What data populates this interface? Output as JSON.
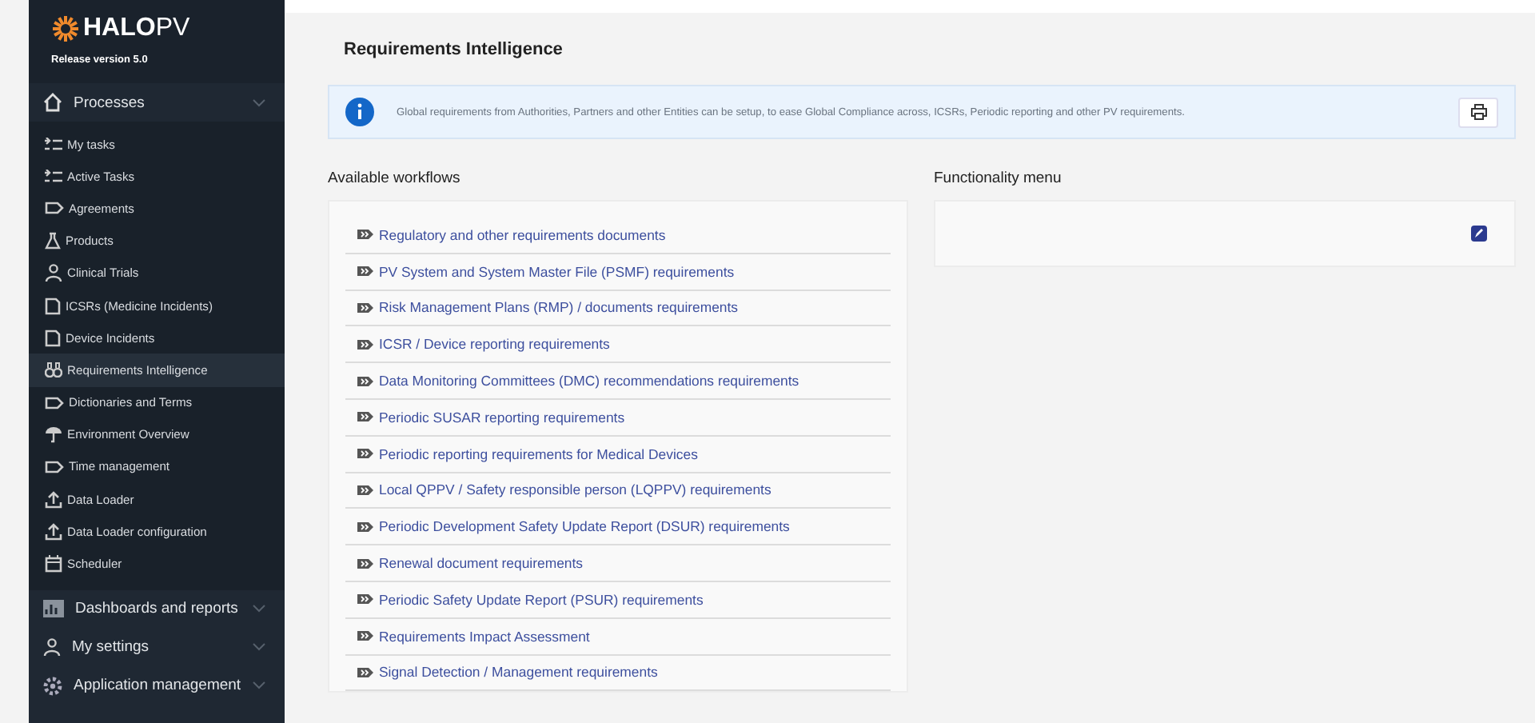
{
  "sidebar": {
    "logo": {
      "brand_bold": "HALO",
      "brand_light": "PV"
    },
    "release": "Release version 5.0",
    "sections": [
      {
        "label": "Processes",
        "expanded": true,
        "items": [
          {
            "label": "My tasks",
            "selected": false
          },
          {
            "label": "Active Tasks",
            "selected": false
          },
          {
            "label": "Agreements",
            "selected": false
          },
          {
            "label": "Products",
            "selected": false
          },
          {
            "label": "Clinical Trials",
            "selected": false
          },
          {
            "label": "ICSRs (Medicine Incidents)",
            "selected": false
          },
          {
            "label": "Device Incidents",
            "selected": false
          },
          {
            "label": "Requirements Intelligence",
            "selected": true
          },
          {
            "label": "Dictionaries and Terms",
            "selected": false
          },
          {
            "label": "Environment Overview",
            "selected": false
          },
          {
            "label": "Time management",
            "selected": false
          },
          {
            "label": "Data Loader",
            "selected": false
          },
          {
            "label": "Data Loader configuration",
            "selected": false
          },
          {
            "label": "Scheduler",
            "selected": false
          }
        ]
      },
      {
        "label": "Dashboards and reports",
        "expanded": false
      },
      {
        "label": "My settings",
        "expanded": false
      },
      {
        "label": "Application management",
        "expanded": false
      }
    ]
  },
  "page": {
    "title": "Requirements Intelligence",
    "info": "Global requirements from Authorities, Partners and other Entities can be setup, to ease Global Compliance across, ICSRs, Periodic reporting and other PV requirements.",
    "workflows": {
      "heading": "Available workflows",
      "items": [
        "Regulatory and other requirements documents",
        "PV System and System Master File (PSMF) requirements",
        "Risk Management Plans (RMP) / documents requirements",
        "ICSR / Device reporting requirements",
        "Data Monitoring Committees (DMC) recommendations requirements",
        "Periodic SUSAR reporting requirements",
        "Periodic reporting requirements for Medical Devices",
        "Local QPPV / Safety responsible person (LQPPV) requirements",
        "Periodic Development Safety Update Report (DSUR) requirements",
        "Renewal document requirements",
        "Periodic Safety Update Report (PSUR) requirements",
        "Requirements Impact Assessment",
        "Signal Detection / Management requirements"
      ]
    },
    "functionality": {
      "heading": "Functionality menu"
    }
  }
}
